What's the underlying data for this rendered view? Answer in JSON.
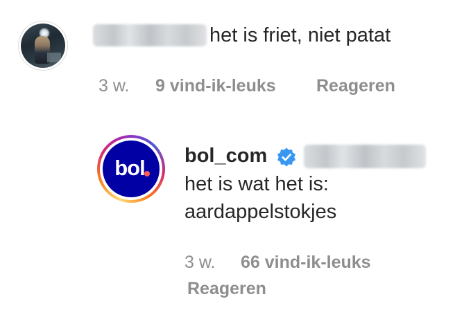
{
  "comment": {
    "text": "het is friet, niet patat",
    "time": "3 w.",
    "likes": "9 vind-ik-leuks",
    "reply_label": "Reageren"
  },
  "reply": {
    "username": "bol_com",
    "logo_text": "bol",
    "text_line1": "het is wat het is:",
    "text_line2": "aardappelstokjes",
    "time": "3 w.",
    "likes": "66 vind-ik-leuks",
    "reply_label": "Reageren"
  },
  "icons": {
    "verified": "verified-badge-icon"
  },
  "colors": {
    "text_primary": "#262626",
    "text_secondary": "#8e8e8e",
    "verified_blue": "#3897f0",
    "bol_brand_blue": "#0000a4"
  }
}
